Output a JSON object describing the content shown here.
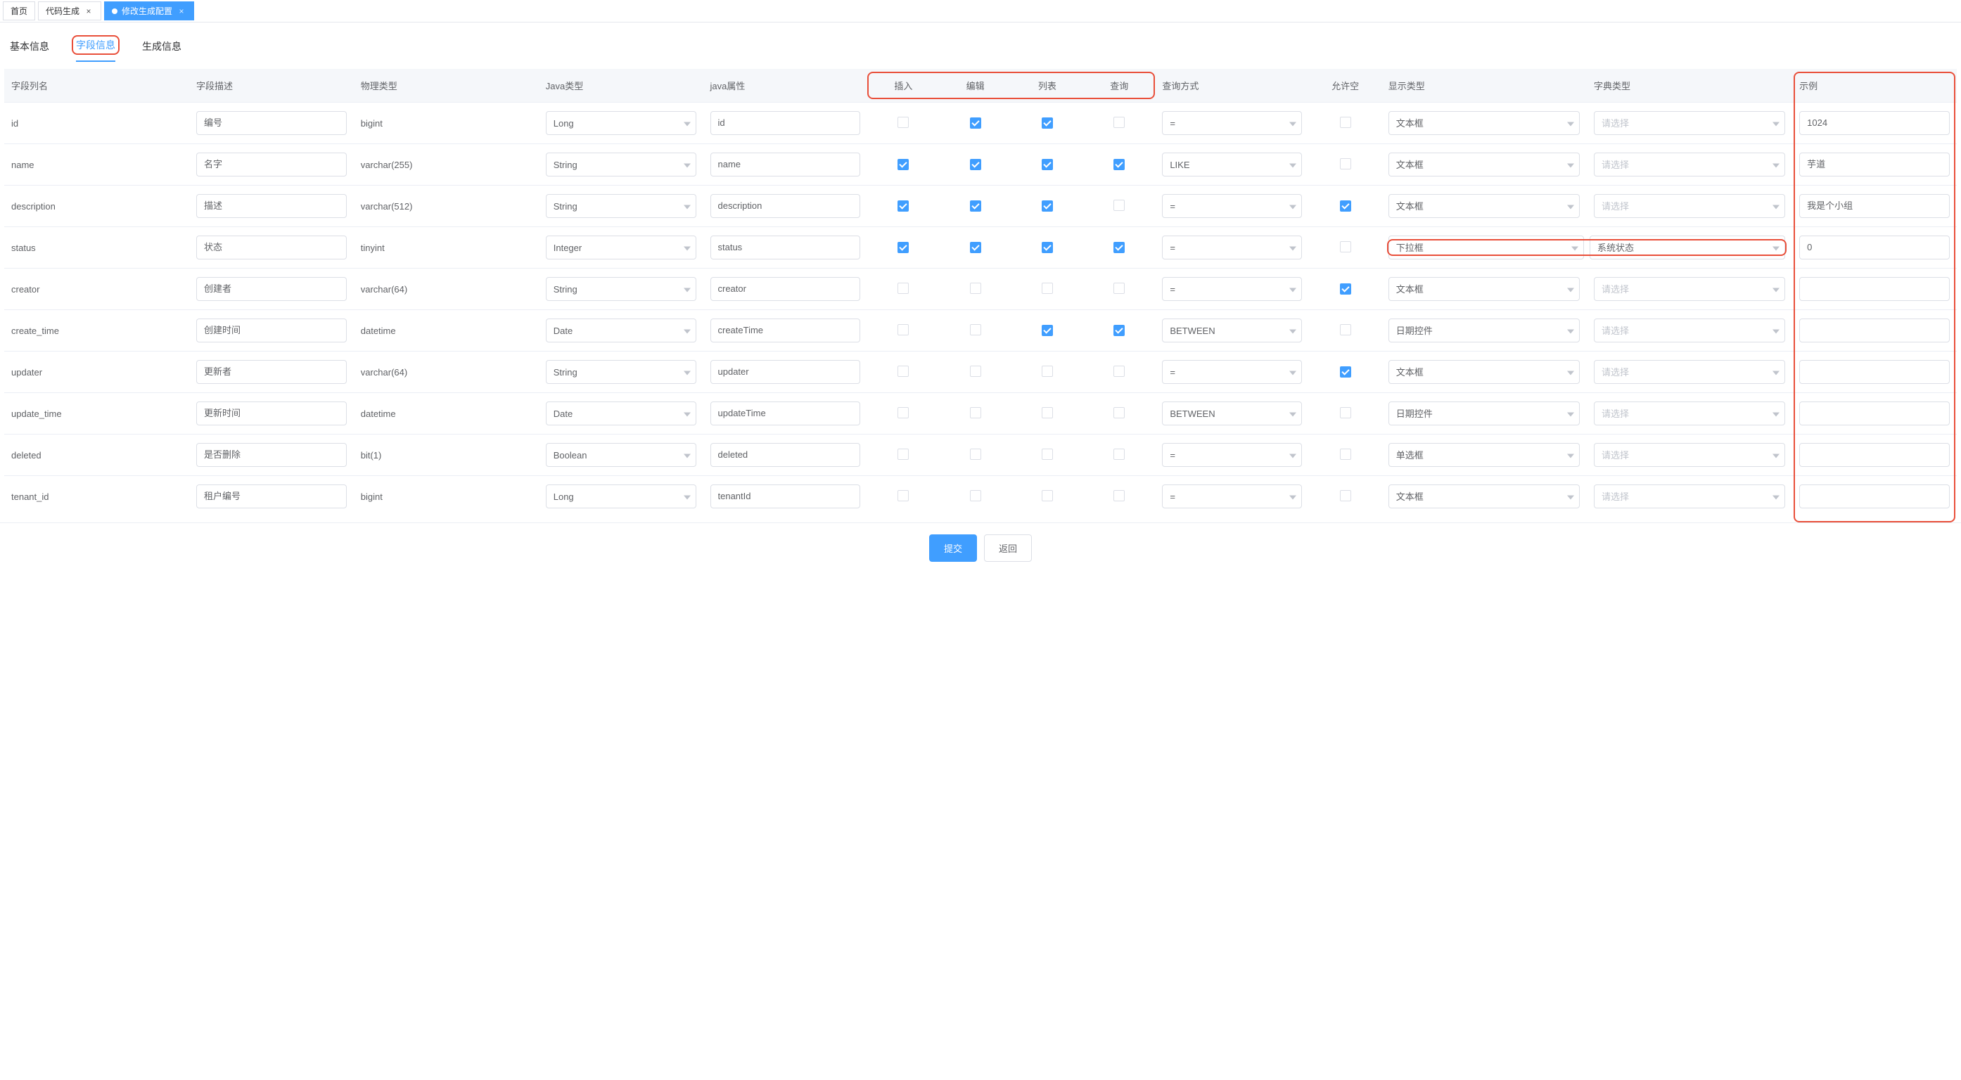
{
  "topTabs": {
    "home": "首页",
    "codeGen": "代码生成",
    "editGen": "修改生成配置"
  },
  "subTabs": {
    "basic": "基本信息",
    "fields": "字段信息",
    "gen": "生成信息"
  },
  "headers": {
    "colName": "字段列名",
    "colDesc": "字段描述",
    "physType": "物理类型",
    "javaType": "Java类型",
    "javaProp": "java属性",
    "insert": "插入",
    "edit": "编辑",
    "list": "列表",
    "query": "查询",
    "queryType": "查询方式",
    "allowNull": "允许空",
    "displayType": "显示类型",
    "dictType": "字典类型",
    "example": "示例"
  },
  "dictPlaceholder": "请选择",
  "buttons": {
    "submit": "提交",
    "back": "返回"
  },
  "rows": [
    {
      "colName": "id",
      "colDesc": "编号",
      "physType": "bigint",
      "javaType": "Long",
      "javaProp": "id",
      "insert": false,
      "edit": true,
      "list": true,
      "query": false,
      "queryType": "=",
      "allowNull": false,
      "displayType": "文本框",
      "dictType": "",
      "example": "1024"
    },
    {
      "colName": "name",
      "colDesc": "名字",
      "physType": "varchar(255)",
      "javaType": "String",
      "javaProp": "name",
      "insert": true,
      "edit": true,
      "list": true,
      "query": true,
      "queryType": "LIKE",
      "allowNull": false,
      "displayType": "文本框",
      "dictType": "",
      "example": "芋道"
    },
    {
      "colName": "description",
      "colDesc": "描述",
      "physType": "varchar(512)",
      "javaType": "String",
      "javaProp": "description",
      "insert": true,
      "edit": true,
      "list": true,
      "query": false,
      "queryType": "=",
      "allowNull": true,
      "displayType": "文本框",
      "dictType": "",
      "example": "我是个小组"
    },
    {
      "colName": "status",
      "colDesc": "状态",
      "physType": "tinyint",
      "javaType": "Integer",
      "javaProp": "status",
      "insert": true,
      "edit": true,
      "list": true,
      "query": true,
      "queryType": "=",
      "allowNull": false,
      "displayType": "下拉框",
      "dictType": "系统状态",
      "example": "0"
    },
    {
      "colName": "creator",
      "colDesc": "创建者",
      "physType": "varchar(64)",
      "javaType": "String",
      "javaProp": "creator",
      "insert": false,
      "edit": false,
      "list": false,
      "query": false,
      "queryType": "=",
      "allowNull": true,
      "displayType": "文本框",
      "dictType": "",
      "example": ""
    },
    {
      "colName": "create_time",
      "colDesc": "创建时间",
      "physType": "datetime",
      "javaType": "Date",
      "javaProp": "createTime",
      "insert": false,
      "edit": false,
      "list": true,
      "query": true,
      "queryType": "BETWEEN",
      "allowNull": false,
      "displayType": "日期控件",
      "dictType": "",
      "example": ""
    },
    {
      "colName": "updater",
      "colDesc": "更新者",
      "physType": "varchar(64)",
      "javaType": "String",
      "javaProp": "updater",
      "insert": false,
      "edit": false,
      "list": false,
      "query": false,
      "queryType": "=",
      "allowNull": true,
      "displayType": "文本框",
      "dictType": "",
      "example": ""
    },
    {
      "colName": "update_time",
      "colDesc": "更新时间",
      "physType": "datetime",
      "javaType": "Date",
      "javaProp": "updateTime",
      "insert": false,
      "edit": false,
      "list": false,
      "query": false,
      "queryType": "BETWEEN",
      "allowNull": false,
      "displayType": "日期控件",
      "dictType": "",
      "example": ""
    },
    {
      "colName": "deleted",
      "colDesc": "是否删除",
      "physType": "bit(1)",
      "javaType": "Boolean",
      "javaProp": "deleted",
      "insert": false,
      "edit": false,
      "list": false,
      "query": false,
      "queryType": "=",
      "allowNull": false,
      "displayType": "单选框",
      "dictType": "",
      "example": ""
    },
    {
      "colName": "tenant_id",
      "colDesc": "租户编号",
      "physType": "bigint",
      "javaType": "Long",
      "javaProp": "tenantId",
      "insert": false,
      "edit": false,
      "list": false,
      "query": false,
      "queryType": "=",
      "allowNull": false,
      "displayType": "文本框",
      "dictType": "",
      "example": ""
    }
  ],
  "highlights": {
    "subtab": 1,
    "headerGroupCols": [
      "insert",
      "edit",
      "list",
      "query"
    ],
    "exampleHeader": true,
    "row3Pair": true
  }
}
